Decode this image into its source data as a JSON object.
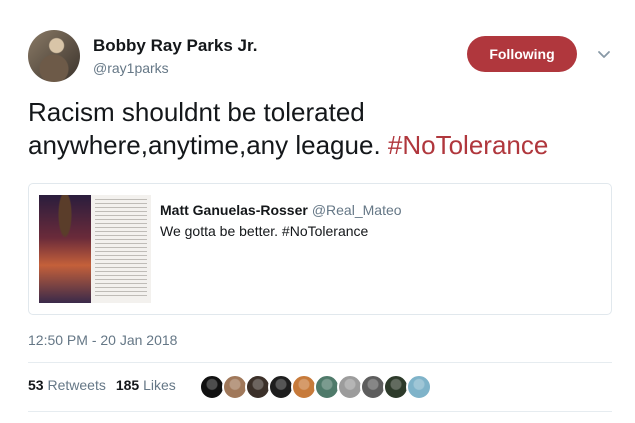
{
  "author": {
    "name": "Bobby Ray Parks Jr.",
    "handle": "@ray1parks"
  },
  "follow_button": {
    "label": "Following",
    "color": "#b0373d"
  },
  "tweet": {
    "text": "Racism shouldnt be tolerated anywhere,anytime,any league. ",
    "hashtag": "#NoTolerance"
  },
  "quoted_tweet": {
    "name": "Matt Ganuelas-Rosser",
    "handle": "@Real_Mateo",
    "text": "We gotta be better. #NoTolerance"
  },
  "timestamp": "12:50 PM - 20 Jan 2018",
  "stats": {
    "retweets_count": "53",
    "retweets_label": "Retweets",
    "likes_count": "185",
    "likes_label": "Likes"
  },
  "likers": [
    {
      "icon": "avatar",
      "color": "#111111"
    },
    {
      "icon": "avatar",
      "color": "#a0785a"
    },
    {
      "icon": "avatar",
      "color": "#3b3029"
    },
    {
      "icon": "avatar",
      "color": "#1e1e1e"
    },
    {
      "icon": "avatar",
      "color": "#c77a3a"
    },
    {
      "icon": "avatar",
      "color": "#4f7a6a"
    },
    {
      "icon": "avatar",
      "color": "#9c9c9c"
    },
    {
      "icon": "avatar",
      "color": "#5d5d5d"
    },
    {
      "icon": "avatar",
      "color": "#2d3a2a"
    },
    {
      "icon": "avatar",
      "color": "#7fb3c9"
    }
  ],
  "colors": {
    "accent": "#b0373d",
    "muted": "#657786",
    "border": "#e1e8ed"
  }
}
